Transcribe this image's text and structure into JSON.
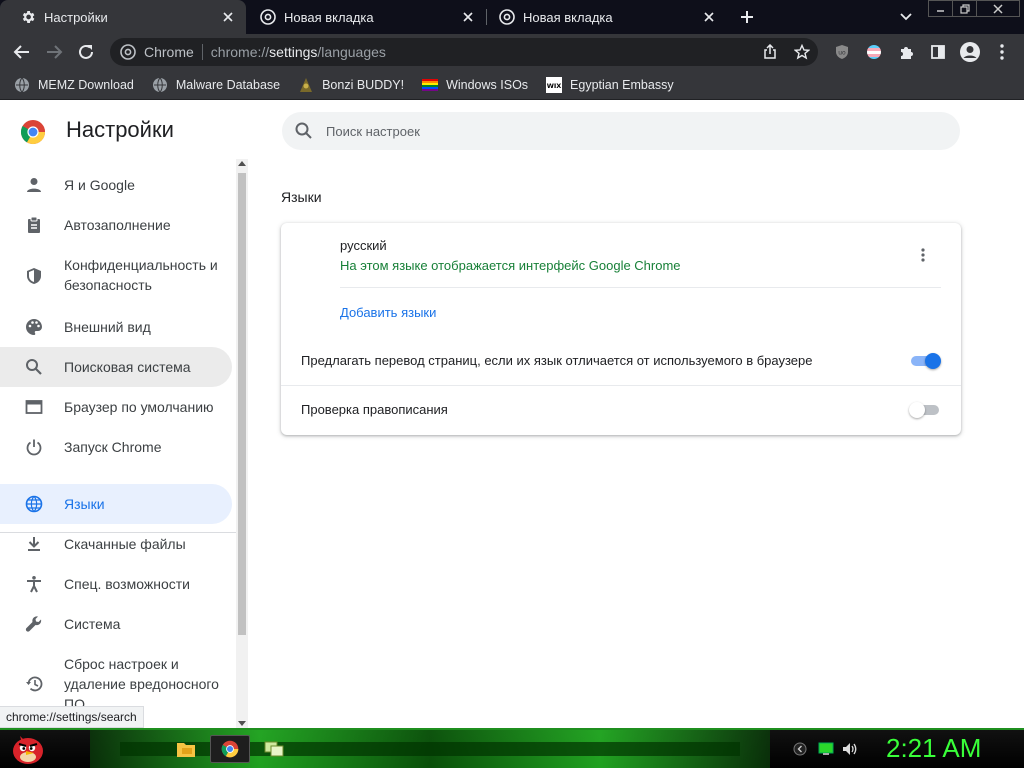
{
  "tabs": [
    {
      "title": "Настройки",
      "active": true
    },
    {
      "title": "Новая вкладка",
      "active": false
    },
    {
      "title": "Новая вкладка",
      "active": false
    }
  ],
  "omnibox": {
    "site_chip": "Chrome",
    "url_scheme": "chrome://",
    "url_host": "settings",
    "url_path": "/languages"
  },
  "bookmarks": [
    {
      "label": "MEMZ Download",
      "icon": "globe-icon"
    },
    {
      "label": "Malware Database",
      "icon": "globe-icon"
    },
    {
      "label": "Bonzi BUDDY!",
      "icon": "bonzi-icon"
    },
    {
      "label": "Windows ISOs",
      "icon": "rainbow-flag-icon"
    },
    {
      "label": "Egyptian Embassy",
      "icon": "wix-icon"
    }
  ],
  "settings": {
    "title": "Настройки",
    "search_placeholder": "Поиск настроек",
    "nav": [
      {
        "label": "Я и Google",
        "icon": "person-icon"
      },
      {
        "label": "Автозаполнение",
        "icon": "clipboard-icon"
      },
      {
        "label": "Конфиденциальность и безопасность",
        "icon": "shield-icon"
      },
      {
        "label": "Внешний вид",
        "icon": "palette-icon"
      },
      {
        "label": "Поисковая система",
        "icon": "search-icon",
        "state": "hovered"
      },
      {
        "label": "Браузер по умолчанию",
        "icon": "browser-window-icon"
      },
      {
        "label": "Запуск Chrome",
        "icon": "power-icon"
      },
      {
        "label": "Языки",
        "icon": "globe-icon",
        "state": "selected"
      },
      {
        "label": "Скачанные файлы",
        "icon": "download-icon"
      },
      {
        "label": "Спец. возможности",
        "icon": "accessibility-icon"
      },
      {
        "label": "Система",
        "icon": "wrench-icon"
      },
      {
        "label": "Сброс настроек и удаление вредоносного ПО",
        "icon": "restore-icon"
      }
    ],
    "section_title": "Языки",
    "language": {
      "name": "русский",
      "description": "На этом языке отображается интерфейс Google Chrome"
    },
    "add_languages": "Добавить языки",
    "translate_label": "Предлагать перевод страниц, если их язык отличается от используемого в браузере",
    "translate_enabled": true,
    "spellcheck_label": "Проверка правописания",
    "spellcheck_enabled": false
  },
  "status_url": "chrome://settings/search",
  "taskbar": {
    "clock": "2:21 AM"
  },
  "colors": {
    "accent": "#1a73e8",
    "success_text": "#188038",
    "clock": "#39ff39"
  }
}
